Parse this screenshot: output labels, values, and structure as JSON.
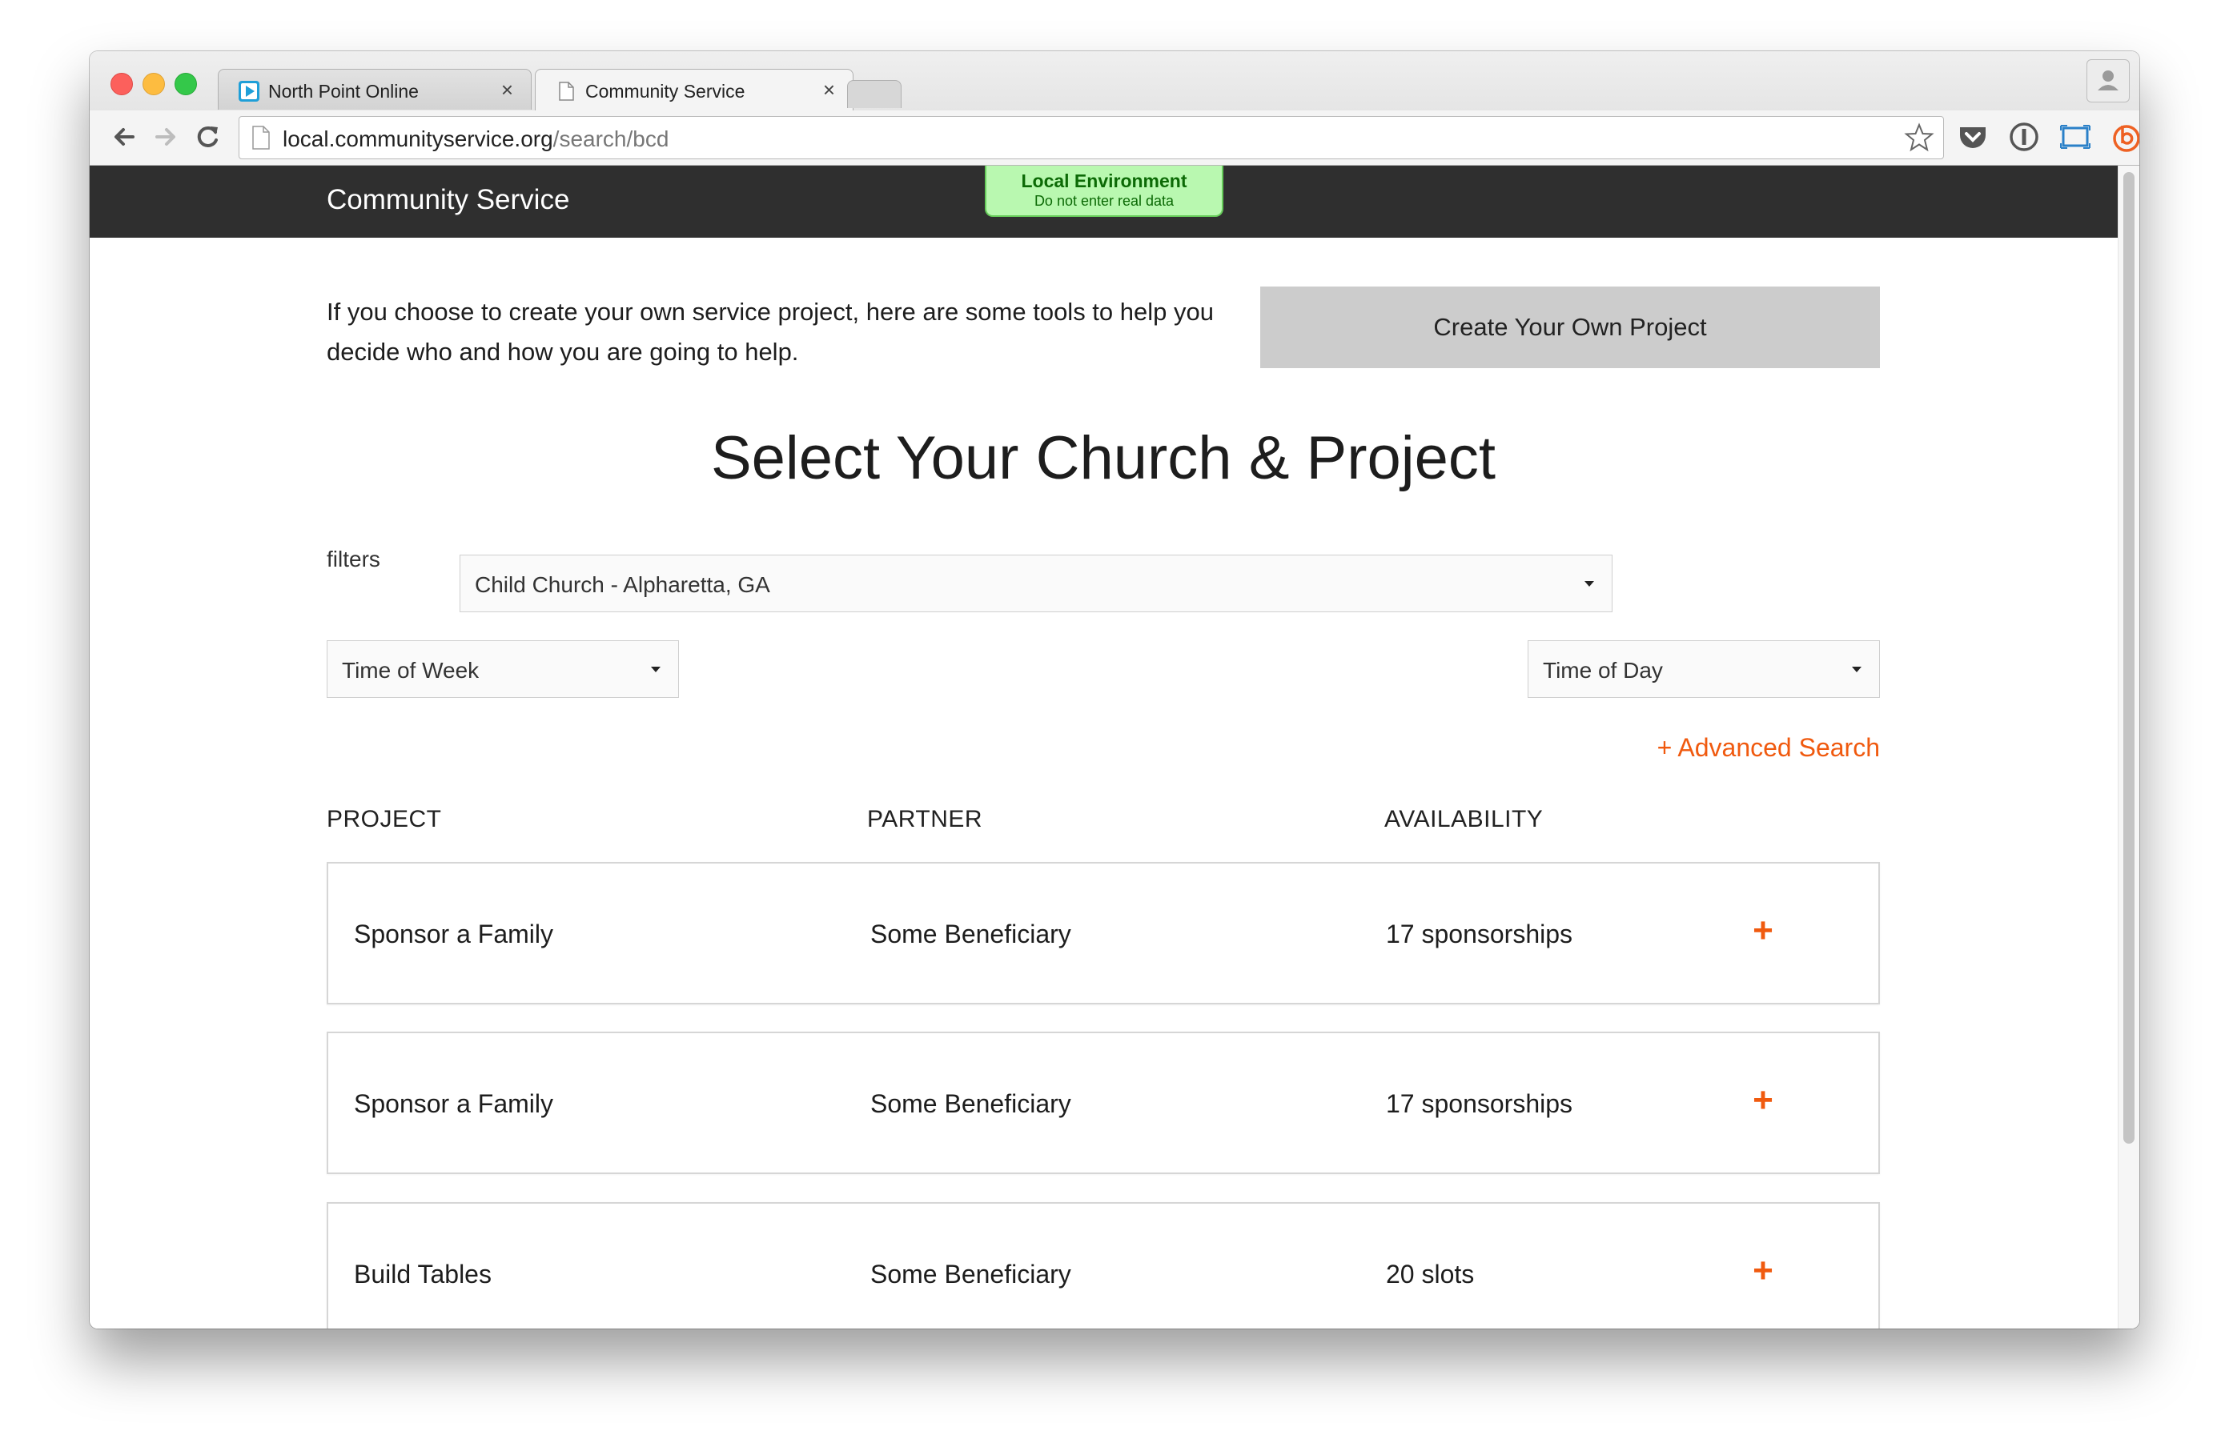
{
  "browser": {
    "tabs": [
      {
        "title": "North Point Online",
        "close": "×"
      },
      {
        "title": "Community Service",
        "close": "×"
      }
    ],
    "url_host": "local.communityservice.org",
    "url_path": "/search/bcd"
  },
  "site": {
    "brand": "Community Service",
    "env_badge": {
      "title": "Local Environment",
      "subtitle": "Do not enter real data"
    }
  },
  "intro": {
    "text": "If you choose to create your own service project, here are some tools to help you decide who and how you are going to help.",
    "create_button": "Create Your Own Project"
  },
  "search": {
    "title": "Select Your Church & Project",
    "filters_label": "filters",
    "church_select": "Child Church - Alpharetta, GA",
    "week_select": "Time of Week",
    "day_select": "Time of Day",
    "advanced_link": "+ Advanced Search"
  },
  "table": {
    "headers": [
      "PROJECT",
      "PARTNER",
      "AVAILABILITY"
    ],
    "rows": [
      {
        "project": "Sponsor a Family",
        "partner": "Some Beneficiary",
        "availability": "17 sponsorships",
        "action": "+"
      },
      {
        "project": "Sponsor a Family",
        "partner": "Some Beneficiary",
        "availability": "17 sponsorships",
        "action": "+"
      },
      {
        "project": "Build Tables",
        "partner": "Some Beneficiary",
        "availability": "20 slots",
        "action": "+"
      }
    ]
  },
  "colors": {
    "accent": "#f05a0f",
    "header_bg": "#2f2f2f",
    "badge_bg": "#b9f8b0"
  }
}
